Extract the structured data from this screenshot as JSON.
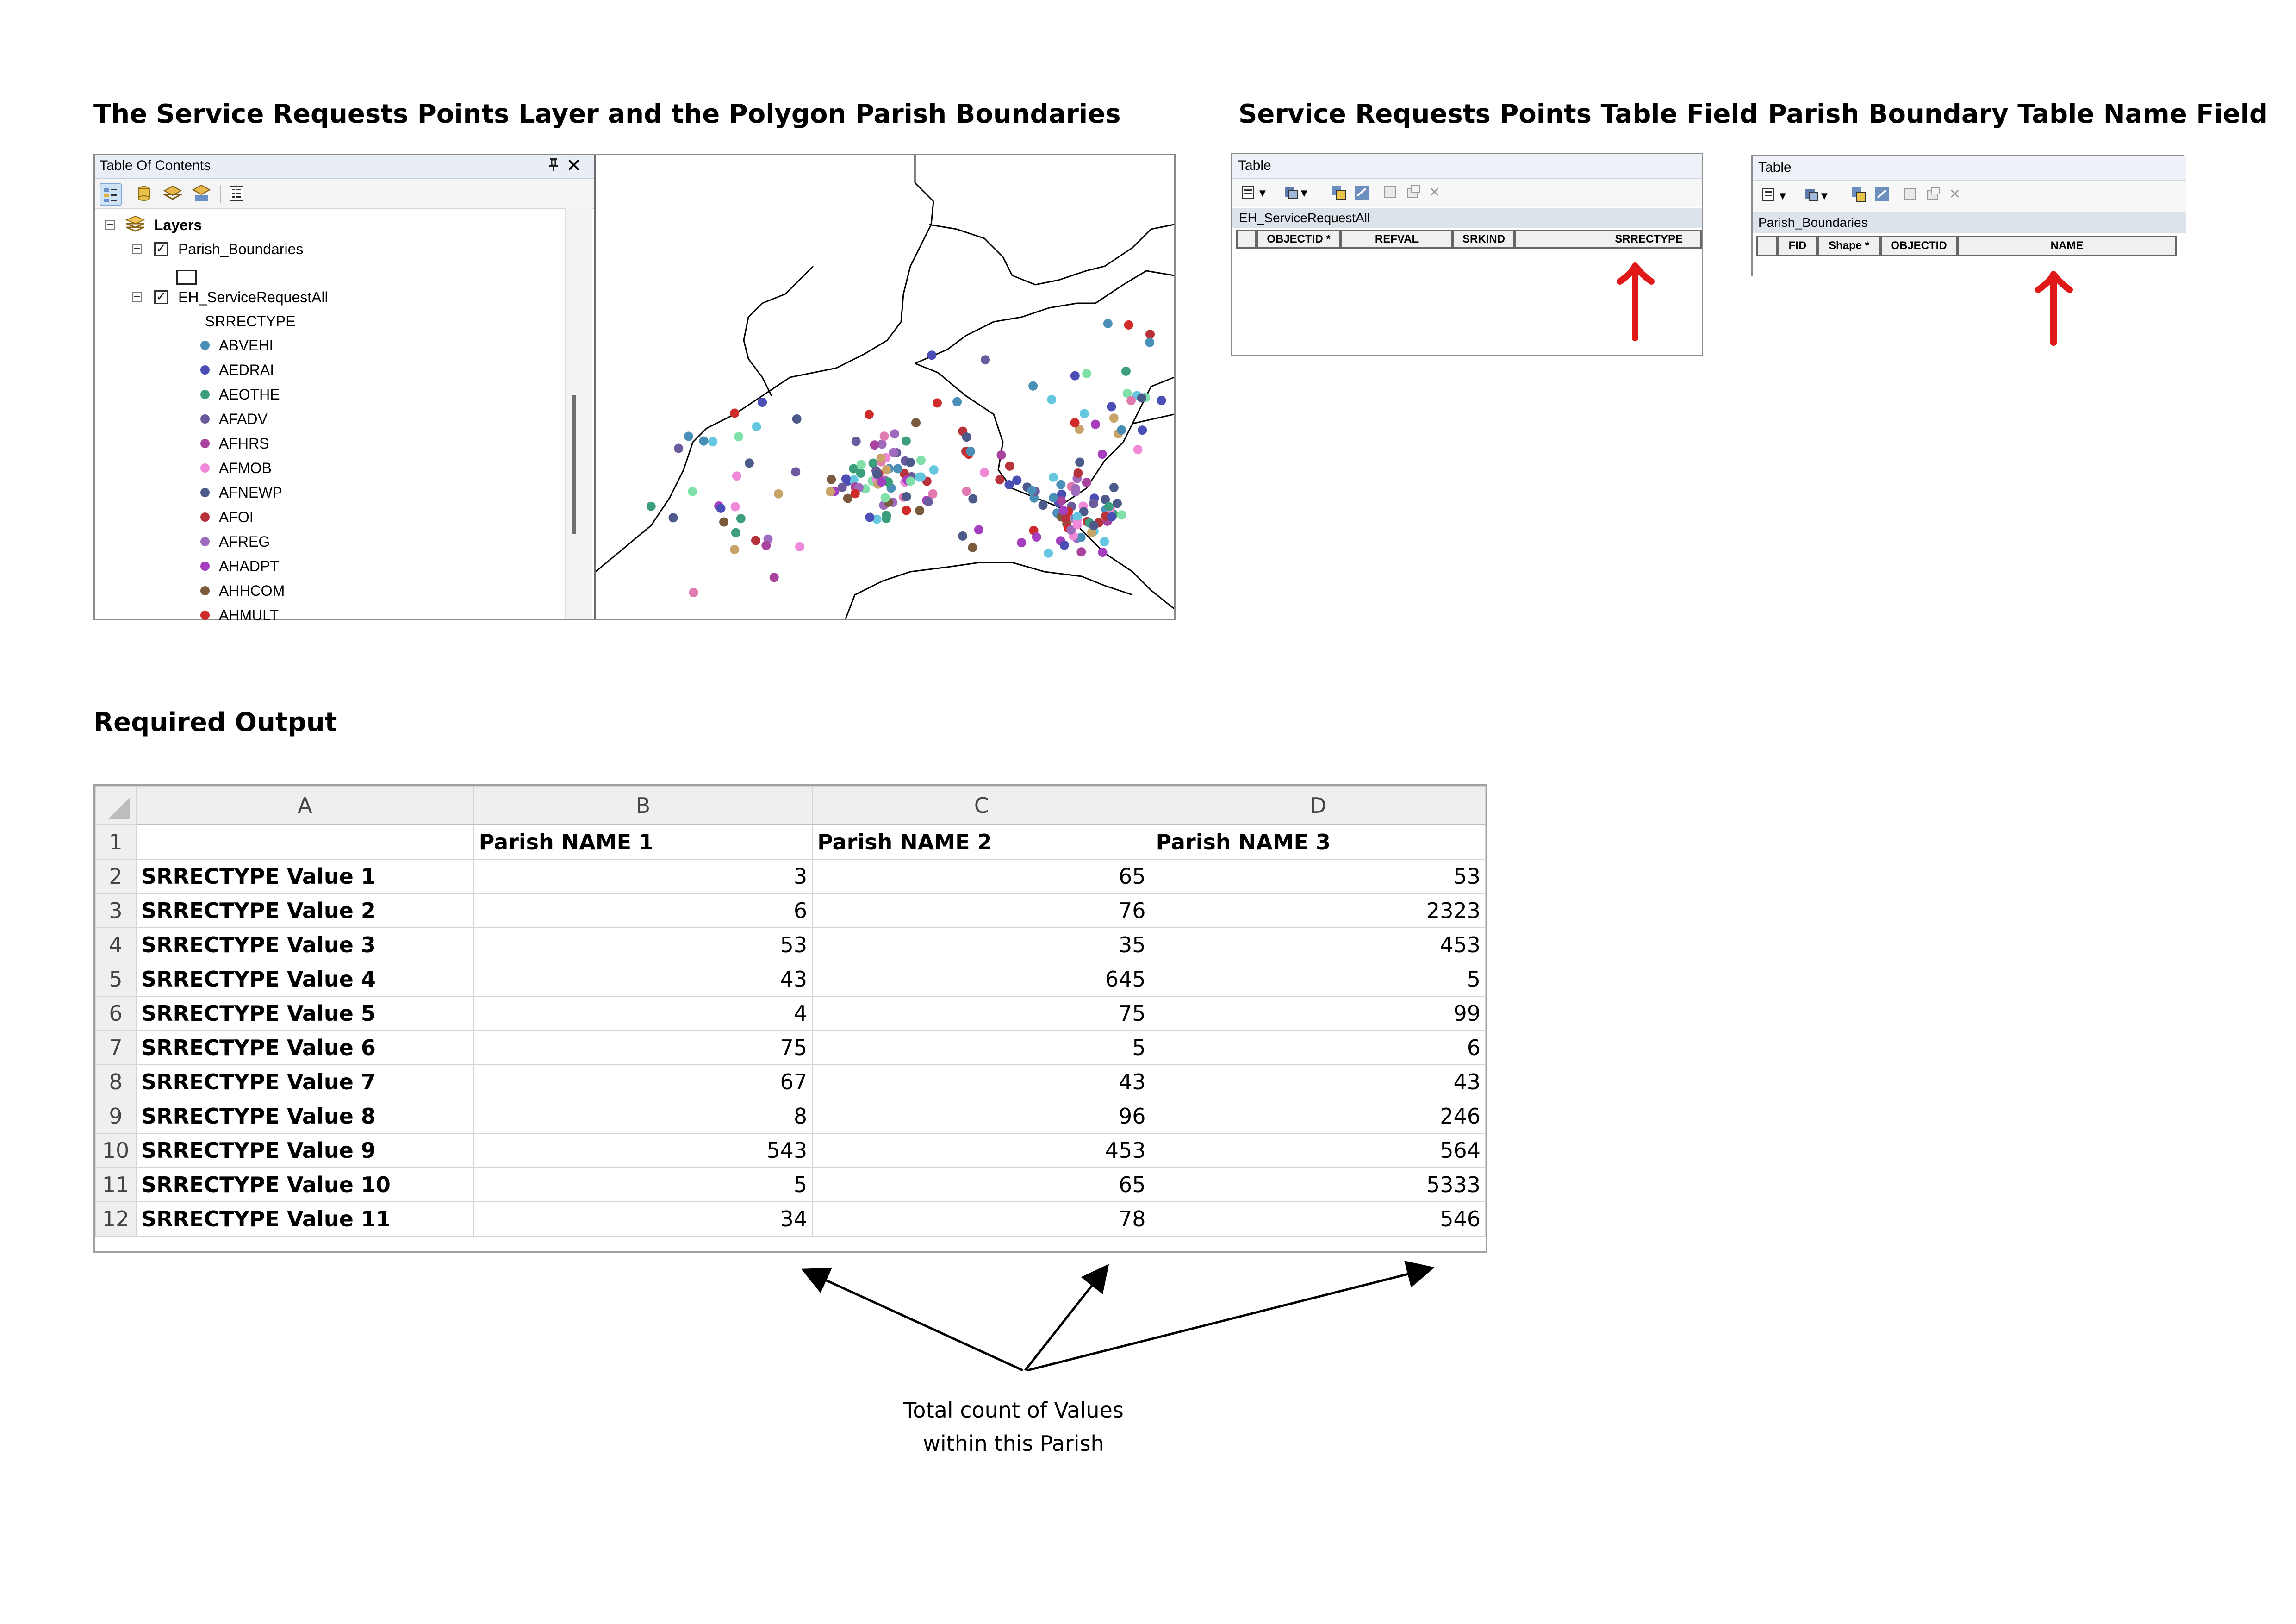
{
  "headings": {
    "map_section": "The Service Requests Points Layer and the Polygon Parish Boundaries",
    "points_table_section": "Service Requests Points Table Field",
    "parish_table_section": "Parish Boundary Table Name Field",
    "output_section": "Required Output"
  },
  "toc": {
    "title": "Table Of Contents",
    "pin_icon": "pin-icon",
    "close_glyph": "✕",
    "root_label": "Layers",
    "layer1": {
      "label": "Parish_Boundaries",
      "checked": true
    },
    "layer2": {
      "label": "EH_ServiceRequestAll",
      "checked": true,
      "field": "SRRECTYPE"
    },
    "legend_items": [
      {
        "label": "ABVEHI",
        "color": "#4a8fb8"
      },
      {
        "label": "AEDRAI",
        "color": "#4b4fb5"
      },
      {
        "label": "AEOTHE",
        "color": "#3c9e7c"
      },
      {
        "label": "AFADV",
        "color": "#6b5b9c"
      },
      {
        "label": "AFHRS",
        "color": "#a9449e"
      },
      {
        "label": "AFMOB",
        "color": "#f08ad8"
      },
      {
        "label": "AFNEWP",
        "color": "#4b5a8a"
      },
      {
        "label": "AFOI",
        "color": "#b8323c"
      },
      {
        "label": "AFREG",
        "color": "#9e6bbd"
      },
      {
        "label": "AHADPT",
        "color": "#a63ec0"
      },
      {
        "label": "AHHCOM",
        "color": "#7a5a3c"
      },
      {
        "label": "AHMULT",
        "color": "#d02b2b"
      }
    ]
  },
  "points_table": {
    "title": "Table",
    "layer_name": "EH_ServiceRequestAll",
    "fields": [
      "OBJECTID *",
      "REFVAL",
      "SRKIND",
      "SRRECTYPE"
    ]
  },
  "parish_table": {
    "title": "Table",
    "layer_name": "Parish_Boundaries",
    "fields": [
      "FID",
      "Shape *",
      "OBJECTID",
      "NAME"
    ]
  },
  "sheet": {
    "columns": [
      "A",
      "B",
      "C",
      "D"
    ],
    "header_row": [
      "",
      "Parish NAME 1",
      "Parish NAME 2",
      "Parish NAME 3"
    ],
    "rows": [
      {
        "label": "SRRECTYPE Value 1",
        "values": [
          "3",
          "65",
          "53"
        ]
      },
      {
        "label": "SRRECTYPE Value 2",
        "values": [
          "6",
          "76",
          "2323"
        ]
      },
      {
        "label": "SRRECTYPE Value 3",
        "values": [
          "53",
          "35",
          "453"
        ]
      },
      {
        "label": "SRRECTYPE Value 4",
        "values": [
          "43",
          "645",
          "5"
        ]
      },
      {
        "label": "SRRECTYPE Value 5",
        "values": [
          "4",
          "75",
          "99"
        ]
      },
      {
        "label": "SRRECTYPE Value 6",
        "values": [
          "75",
          "5",
          "6"
        ]
      },
      {
        "label": "SRRECTYPE Value 7",
        "values": [
          "67",
          "43",
          "43"
        ]
      },
      {
        "label": "SRRECTYPE Value 8",
        "values": [
          "8",
          "96",
          "246"
        ]
      },
      {
        "label": "SRRECTYPE Value 9",
        "values": [
          "543",
          "453",
          "564"
        ]
      },
      {
        "label": "SRRECTYPE Value 10",
        "values": [
          "5",
          "65",
          "5333"
        ]
      },
      {
        "label": "SRRECTYPE Value 11",
        "values": [
          "34",
          "78",
          "546"
        ]
      }
    ]
  },
  "annotation": {
    "line1": "Total count of Values",
    "line2": "within this Parish"
  },
  "colors": {
    "arrow_red": "#e01818",
    "boundary": "#000000"
  }
}
